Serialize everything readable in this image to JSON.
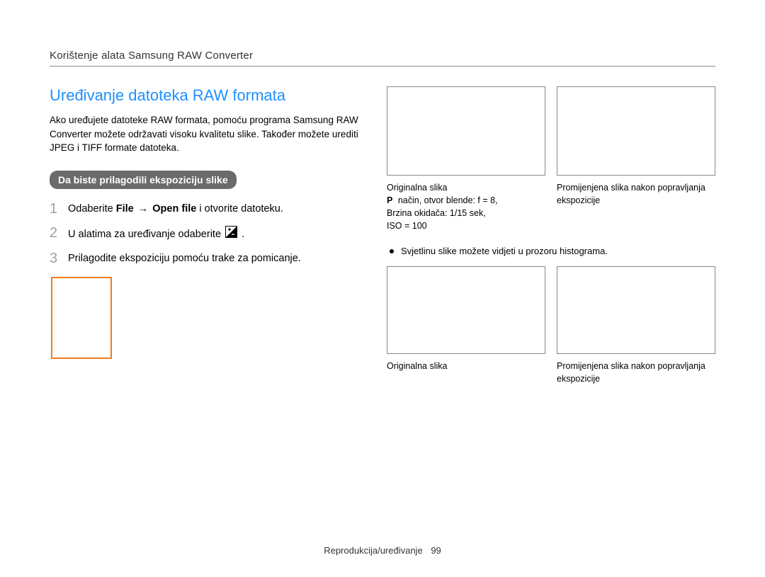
{
  "header_title": "Korištenje alata Samsung RAW Converter",
  "section_heading": "Uređivanje datoteka RAW formata",
  "intro": "Ako uređujete datoteke RAW formata, pomoću programa Samsung RAW Converter možete održavati visoku kvalitetu slike. Također možete urediti JPEG i TIFF formate datoteka.",
  "pill": "Da biste prilagodili ekspoziciju slike",
  "steps": [
    {
      "num": "1",
      "prefix": "Odaberite ",
      "b1": "File",
      "arrow": "→",
      "b2": "Open ﬁle",
      "suffix": " i otvorite datoteku."
    },
    {
      "num": "2",
      "text_before": "U alatima za uređivanje odaberite ",
      "icon": "exposure-icon",
      "text_after": " ."
    },
    {
      "num": "3",
      "text": "Prilagodite ekspoziciju pomoću trake za pomicanje."
    }
  ],
  "captions_top": {
    "left": {
      "title": "Originalna slika",
      "mode_line": " način, otvor blende: f = 8,",
      "shutter": "Brzina okidača: 1/15 sek,",
      "iso": "ISO = 100"
    },
    "right": "Promijenjena slika nakon popravljanja ekspozicije"
  },
  "note": "Svjetlinu slike možete vidjeti u prozoru histograma.",
  "captions_bottom": {
    "left": "Originalna slika",
    "right": "Promijenjena slika nakon popravljanja ekspozicije"
  },
  "footer": {
    "label": "Reprodukcija/uređivanje",
    "page": "99"
  }
}
